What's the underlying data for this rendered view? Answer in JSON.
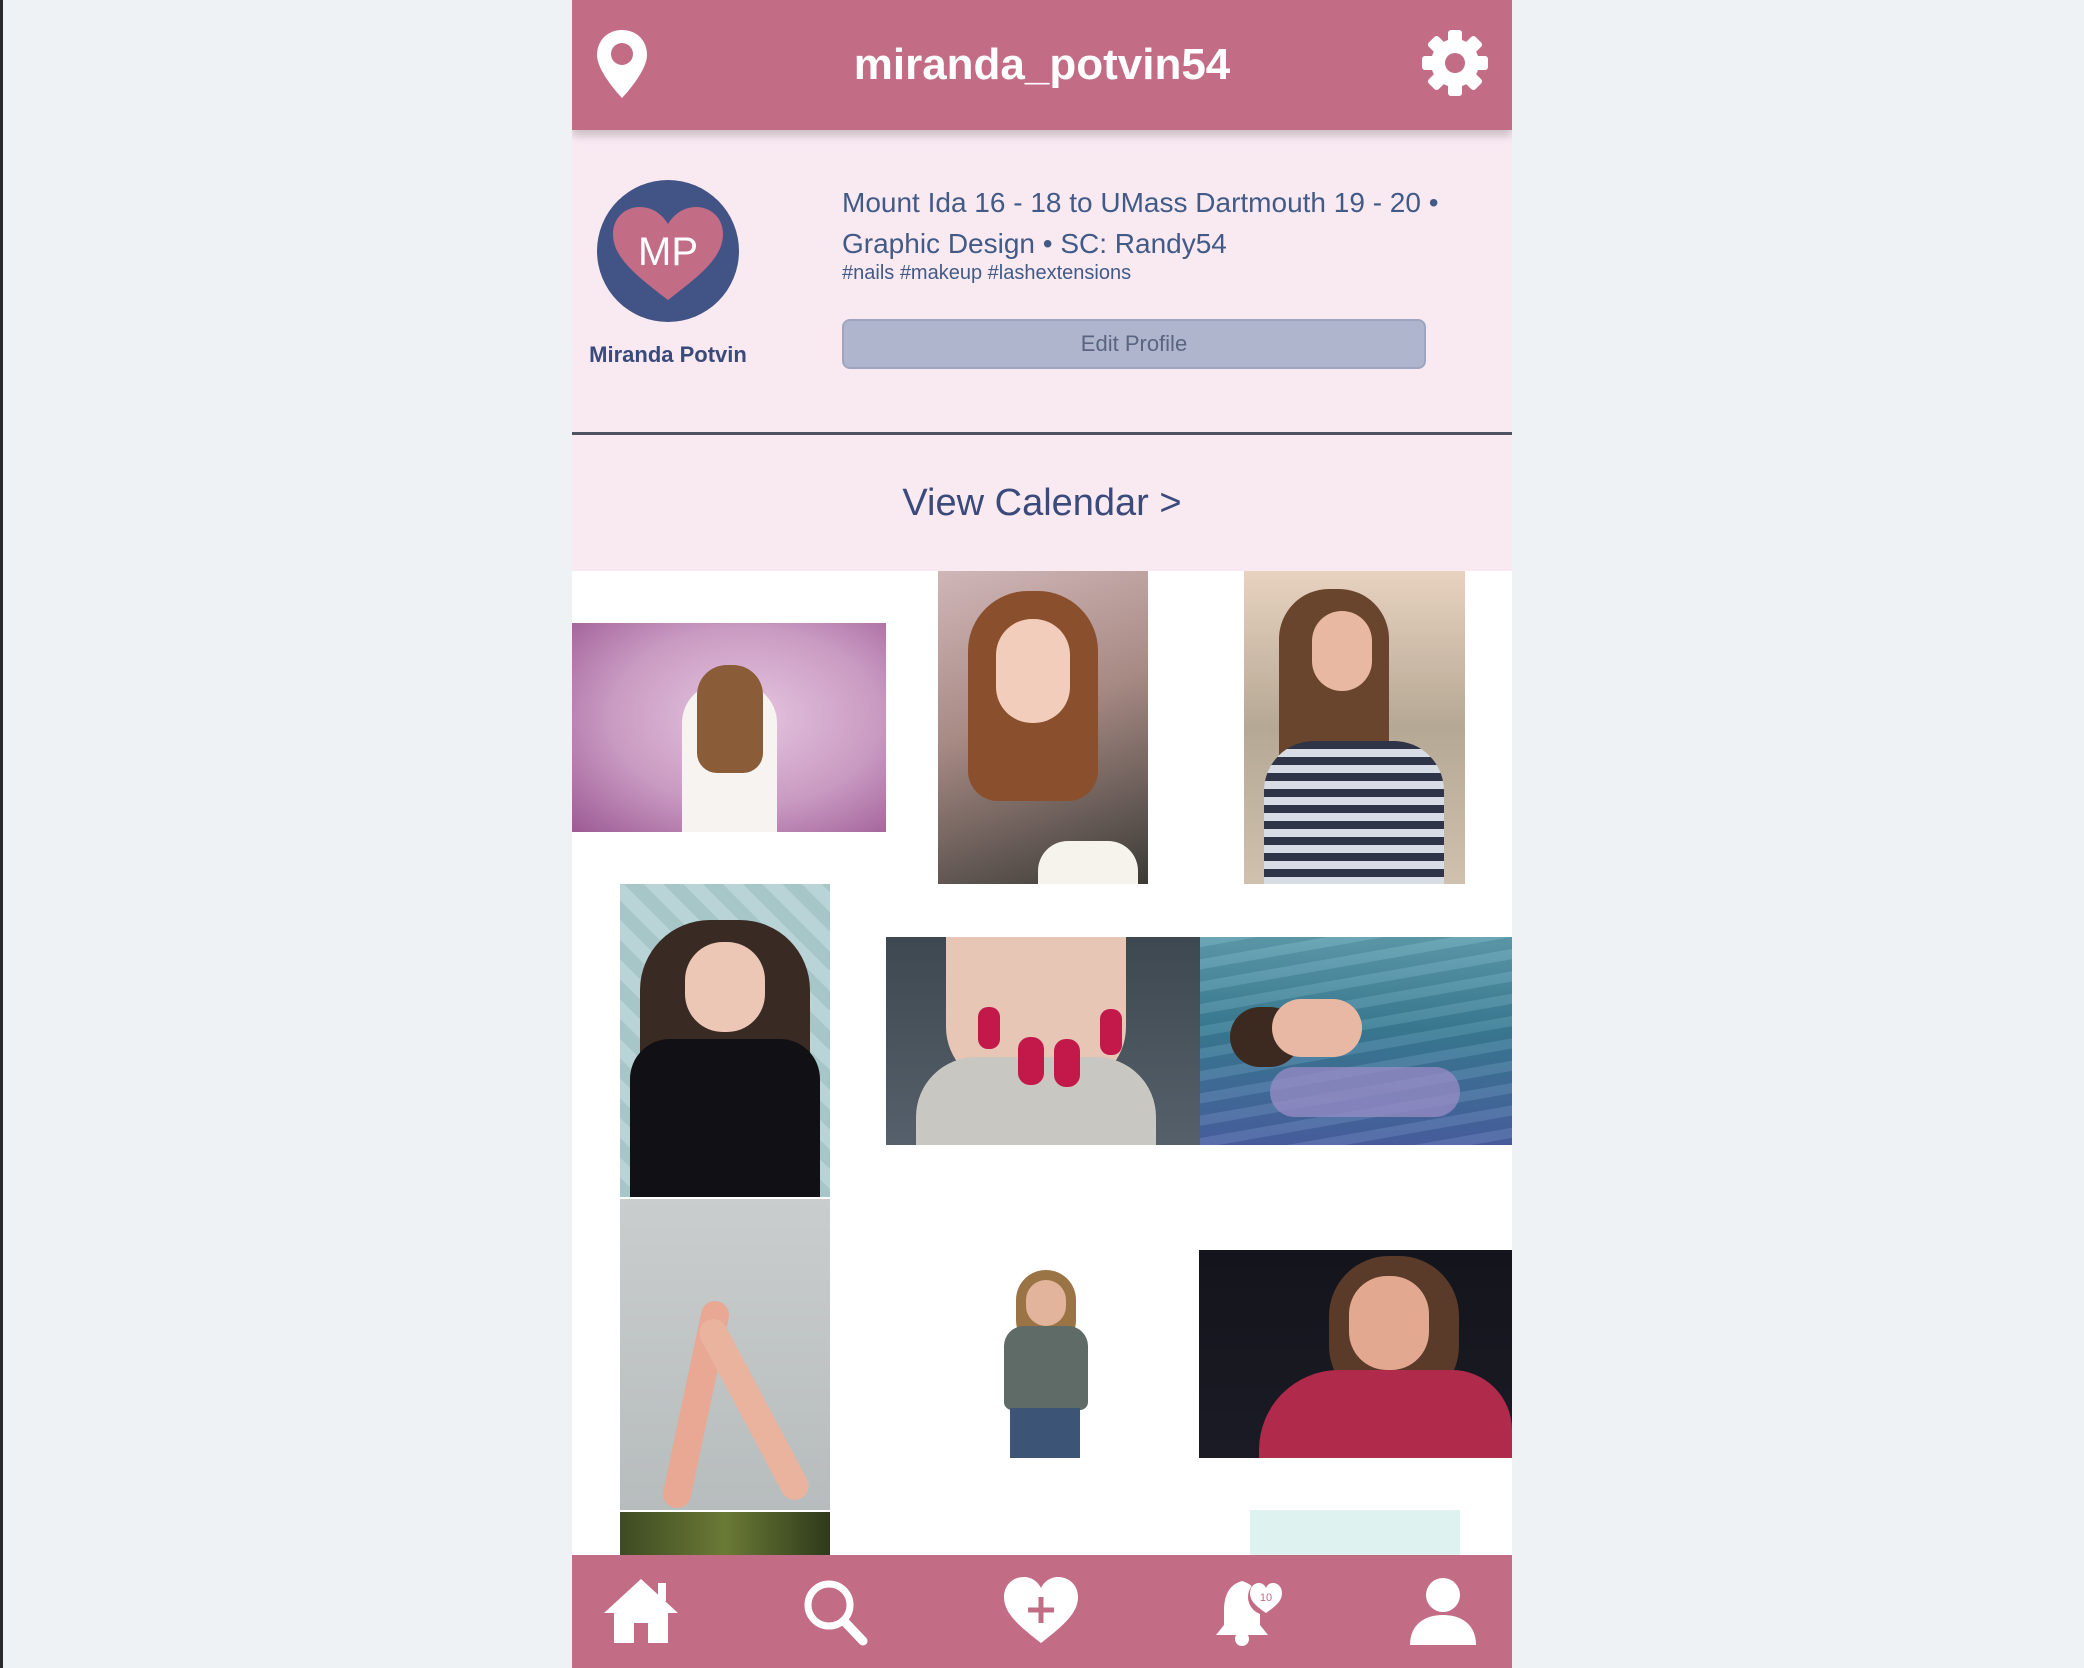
{
  "header": {
    "username": "miranda_potvin54",
    "location_icon": "location-pin-icon",
    "settings_icon": "gear-icon"
  },
  "profile": {
    "avatar_initials": "MP",
    "full_name": "Miranda Potvin",
    "bio_line1": "Mount Ida 16 - 18 to UMass Dartmouth 19 - 20 •",
    "bio_line2": "Graphic Design • SC: Randy54",
    "hashtags": "#nails #makeup #lashextensions",
    "edit_button_label": "Edit Profile"
  },
  "calendar_link": "View Calendar >",
  "photos": [
    "woman-back-lilac-wall",
    "woman-milkshake-straw",
    "woman-striped-shirt-beach",
    "woman-black-sweater-cover-face",
    "pink-heart-nails",
    "woman-floating-water",
    "hands-raised-dark-nails",
    "woman-sunglasses-tshirt",
    "woman-red-top-dark",
    "plant-photo-partial",
    "mint-photo-partial"
  ],
  "bottom_nav": {
    "items": [
      "home-icon",
      "search-icon",
      "heart-plus-icon",
      "notification-bell-icon",
      "profile-icon"
    ],
    "notification_count": "10"
  },
  "colors": {
    "brand_pink": "#c26c86",
    "light_pink": "#f9eaf2",
    "navy": "#425486",
    "button_gray": "#aeb5cc"
  }
}
